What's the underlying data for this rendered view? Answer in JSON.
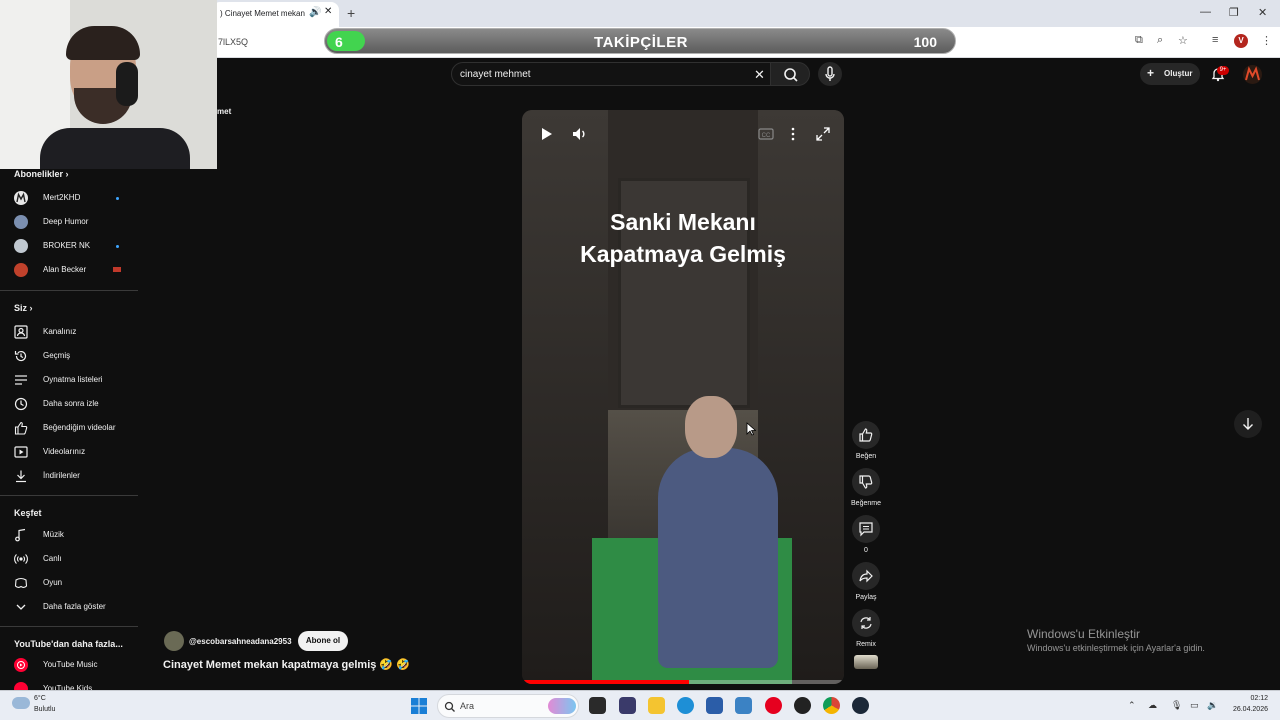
{
  "browser": {
    "tab_title": ") Cinayet Memet mekan",
    "url_fragment": "7lLX5Q",
    "new_tab": "+",
    "win_minimize": "—",
    "win_restore": "❐",
    "win_close": "✕"
  },
  "follower_bar": {
    "current": "6",
    "title": "TAKİPÇİLER",
    "max": "100",
    "progress_fraction": 0.06,
    "fill_color": "#42d44f"
  },
  "youtube": {
    "search_value": "cinayet mehmet",
    "create_label": "Oluştur",
    "notification_count": "9+",
    "behind_webcam_text": "met"
  },
  "sidebar": {
    "subscriptions_title": "Abonelikler",
    "subscriptions": [
      {
        "label": "Mert2KHD",
        "color": "#e8e8e8",
        "new": true
      },
      {
        "label": "Deep Humor",
        "color": "#7b8fb0",
        "new": false
      },
      {
        "label": "BROKER NK",
        "color": "#c0c8d0",
        "new": true
      },
      {
        "label": "Alan Becker",
        "color": "#c0412b",
        "new": false
      }
    ],
    "you_title": "Siz",
    "you_items": [
      {
        "label": "Kanalınız",
        "icon": "channel-icon"
      },
      {
        "label": "Geçmiş",
        "icon": "history-icon"
      },
      {
        "label": "Oynatma listeleri",
        "icon": "playlist-icon"
      },
      {
        "label": "Daha sonra izle",
        "icon": "clock-icon"
      },
      {
        "label": "Beğendiğim videolar",
        "icon": "thumbs-up-icon"
      },
      {
        "label": "Videolarınız",
        "icon": "video-icon"
      },
      {
        "label": "İndirilenler",
        "icon": "download-icon"
      }
    ],
    "explore_title": "Keşfet",
    "explore_items": [
      {
        "label": "Müzik",
        "icon": "music-icon"
      },
      {
        "label": "Canlı",
        "icon": "live-icon"
      },
      {
        "label": "Oyun",
        "icon": "gaming-icon"
      },
      {
        "label": "Daha fazla göster",
        "icon": "chevron-down-icon"
      }
    ],
    "more_title": "YouTube'dan daha fazla...",
    "more_items": [
      {
        "label": "YouTube Music",
        "color": "#ff0033"
      },
      {
        "label": "YouTube Kids",
        "color": "#ff0033"
      }
    ]
  },
  "video": {
    "caption_line1": "Sanki Mekanı",
    "caption_line2": "Kapatmaya Gelmiş",
    "progress_fraction": 0.52
  },
  "actions": [
    {
      "label": "Beğen",
      "icon": "thumbs-up-icon"
    },
    {
      "label": "Beğenme",
      "icon": "thumbs-down-icon"
    },
    {
      "label": "0",
      "icon": "comment-icon"
    },
    {
      "label": "Paylaş",
      "icon": "share-icon"
    },
    {
      "label": "Remix",
      "icon": "remix-icon"
    }
  ],
  "channel": {
    "handle": "@escobarsahneadana2953",
    "subscribe_label": "Abone ol"
  },
  "video_title": "Cinayet Memet mekan kapatmaya gelmiş 🤣 🤣",
  "watermark": {
    "line1": "Windows'u Etkinleştir",
    "line2": "Windows'u etkinleştirmek için Ayarlar'a gidin."
  },
  "taskbar": {
    "weather_temp": "6°C",
    "weather_desc": "Bulutlu",
    "search_placeholder": "Ara",
    "time": "02:12",
    "date": "26.04.2026"
  }
}
